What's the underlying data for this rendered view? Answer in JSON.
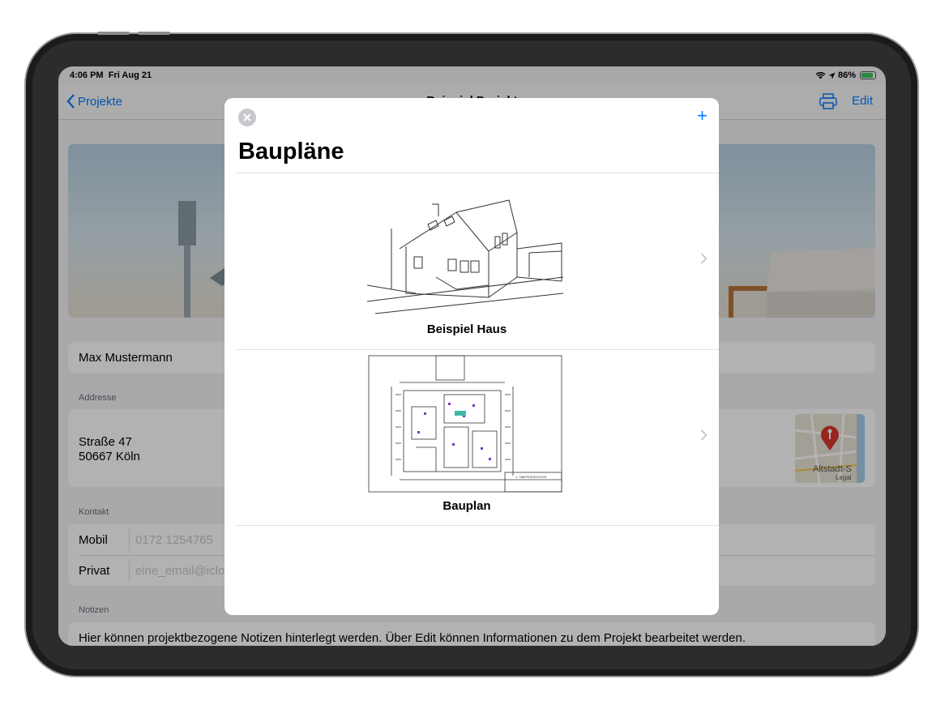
{
  "status_bar": {
    "time": "4:06 PM",
    "date": "Fri Aug 21",
    "battery": "86%",
    "battery_level": 0.86
  },
  "navbar": {
    "back_label": "Projekte",
    "title": "Beispiel Projekt",
    "edit_label": "Edit"
  },
  "project": {
    "name": "Max Mustermann",
    "address_section": "Addresse",
    "street": "Straße 47",
    "city": "50667 Köln",
    "map_label": "Altstadt-S",
    "map_legal": "Legal",
    "contact_section": "Kontakt",
    "contacts": [
      {
        "label": "Mobil",
        "value": "0172 1254765"
      },
      {
        "label": "Privat",
        "value": "eine_email@icloud.com"
      }
    ],
    "notes_section": "Notizen",
    "notes": "Hier können projektbezogene Notizen hinterlegt werden. Über Edit können Informationen zu dem Projekt bearbeitet werden."
  },
  "modal": {
    "title": "Baupläne",
    "add_label": "+",
    "plans": [
      {
        "caption": "Beispiel Haus",
        "thumb_icon": "house-sketch-icon"
      },
      {
        "caption": "Bauplan",
        "thumb_icon": "floorplan-drawing-icon"
      }
    ],
    "plan_footer": "1. OBERGESCHOSS"
  },
  "colors": {
    "accent": "#007aff",
    "map_pin": "#d9342b",
    "background": "#f2f2f7"
  }
}
